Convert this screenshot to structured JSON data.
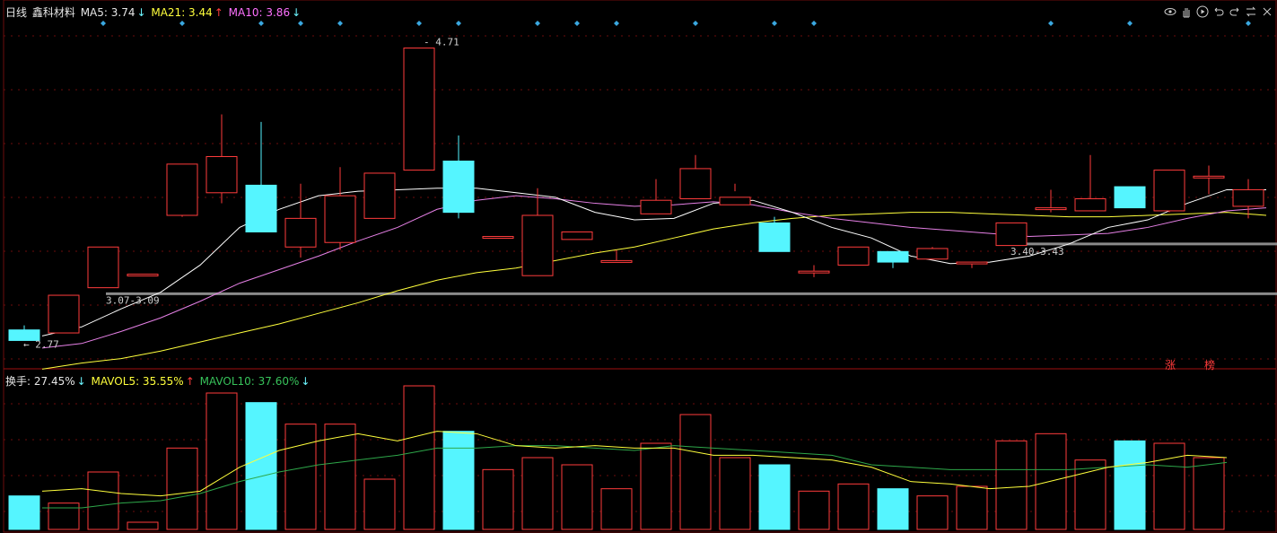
{
  "header": {
    "period": "日线",
    "stock": "鑫科材料",
    "ma5_label": "MA5: 3.74",
    "ma5_arrow": "↓",
    "ma21_label": "MA21: 3.44",
    "ma21_arrow": "↑",
    "ma10_label": "MA10: 3.86",
    "ma10_arrow": "↓"
  },
  "vol_header": {
    "turnover_label": "换手: 27.45%",
    "turnover_arrow": "↓",
    "mavol5_label": "MAVOL5: 35.55%",
    "mavol5_arrow": "↑",
    "mavol10_label": "MAVOL10: 37.60%",
    "mavol10_arrow": "↓"
  },
  "toolbar": {
    "icons": [
      "eye-icon",
      "hand-icon",
      "play-icon",
      "undo-icon",
      "redo-icon",
      "swap-icon",
      "close-icon"
    ]
  },
  "tags": {
    "zhang": "涨",
    "bang": "榜"
  },
  "colors": {
    "up": "#ff3c3c",
    "down": "#55f5ff",
    "ma5": "#ffffff",
    "ma10": "#e680e6",
    "ma21": "#ffff3c",
    "mavol5": "#ffff3c",
    "mavol10": "#2ea84a",
    "grid": "#6b0d0d",
    "support": "#8a8a8a"
  },
  "chart_data": {
    "type": "candlestick",
    "ylim": [
      2.6,
      4.85
    ],
    "candles": [
      {
        "o": 2.84,
        "h": 2.87,
        "l": 2.77,
        "c": 2.77
      },
      {
        "o": 2.82,
        "h": 3.07,
        "l": 2.82,
        "c": 3.07
      },
      {
        "o": 3.12,
        "h": 3.39,
        "l": 3.12,
        "c": 3.39
      },
      {
        "o": 3.21,
        "h": 3.21,
        "l": 3.21,
        "c": 3.21
      },
      {
        "o": 3.6,
        "h": 3.94,
        "l": 3.59,
        "c": 3.94
      },
      {
        "o": 3.75,
        "h": 4.27,
        "l": 3.68,
        "c": 3.99
      },
      {
        "o": 3.8,
        "h": 4.22,
        "l": 3.8,
        "c": 3.49
      },
      {
        "o": 3.39,
        "h": 3.81,
        "l": 3.32,
        "c": 3.58
      },
      {
        "o": 3.42,
        "h": 3.92,
        "l": 3.37,
        "c": 3.73
      },
      {
        "o": 3.58,
        "h": 3.69,
        "l": 3.58,
        "c": 3.88
      },
      {
        "o": 3.9,
        "h": 4.71,
        "l": 3.9,
        "c": 4.71
      },
      {
        "o": 3.96,
        "h": 4.13,
        "l": 3.58,
        "c": 3.62
      },
      {
        "o": 3.46,
        "h": 3.46,
        "l": 3.46,
        "c": 3.46
      },
      {
        "o": 3.2,
        "h": 3.78,
        "l": 3.2,
        "c": 3.6
      },
      {
        "o": 3.44,
        "h": 3.5,
        "l": 3.5,
        "c": 3.49
      },
      {
        "o": 3.3,
        "h": 3.37,
        "l": 3.3,
        "c": 3.3
      },
      {
        "o": 3.61,
        "h": 3.84,
        "l": 3.66,
        "c": 3.7
      },
      {
        "o": 3.71,
        "h": 4.0,
        "l": 3.71,
        "c": 3.91
      },
      {
        "o": 3.67,
        "h": 3.81,
        "l": 3.76,
        "c": 3.72
      },
      {
        "o": 3.55,
        "h": 3.59,
        "l": 3.36,
        "c": 3.36
      },
      {
        "o": 3.23,
        "h": 3.27,
        "l": 3.19,
        "c": 3.23
      },
      {
        "o": 3.27,
        "h": 3.39,
        "l": 3.27,
        "c": 3.39
      },
      {
        "o": 3.36,
        "h": 3.36,
        "l": 3.25,
        "c": 3.29
      },
      {
        "o": 3.31,
        "h": 3.39,
        "l": 3.31,
        "c": 3.38
      },
      {
        "o": 3.29,
        "h": 3.29,
        "l": 3.25,
        "c": 3.29
      },
      {
        "o": 3.4,
        "h": 3.55,
        "l": 3.4,
        "c": 3.55
      },
      {
        "o": 3.65,
        "h": 3.77,
        "l": 3.62,
        "c": 3.65
      },
      {
        "o": 3.63,
        "h": 4.0,
        "l": 3.63,
        "c": 3.71
      },
      {
        "o": 3.79,
        "h": 3.79,
        "l": 3.72,
        "c": 3.65
      },
      {
        "o": 3.63,
        "h": 3.9,
        "l": 3.62,
        "c": 3.9
      },
      {
        "o": 3.86,
        "h": 3.93,
        "l": 3.74,
        "c": 3.86
      },
      {
        "o": 3.66,
        "h": 3.84,
        "l": 3.58,
        "c": 3.77
      }
    ],
    "ma5": [
      2.8,
      2.86,
      2.98,
      3.09,
      3.27,
      3.52,
      3.64,
      3.73,
      3.76,
      3.77,
      3.78,
      3.78,
      3.75,
      3.72,
      3.62,
      3.57,
      3.58,
      3.68,
      3.7,
      3.62,
      3.52,
      3.45,
      3.33,
      3.28,
      3.29,
      3.33,
      3.41,
      3.52,
      3.57,
      3.68,
      3.77,
      3.77
    ],
    "ma10": [
      2.72,
      2.75,
      2.83,
      2.92,
      3.03,
      3.15,
      3.24,
      3.33,
      3.43,
      3.52,
      3.64,
      3.7,
      3.73,
      3.71,
      3.68,
      3.66,
      3.67,
      3.69,
      3.67,
      3.62,
      3.58,
      3.55,
      3.52,
      3.5,
      3.48,
      3.46,
      3.47,
      3.48,
      3.52,
      3.58,
      3.63,
      3.65
    ],
    "ma21": [
      2.58,
      2.62,
      2.65,
      2.7,
      2.76,
      2.82,
      2.88,
      2.95,
      3.02,
      3.1,
      3.17,
      3.22,
      3.25,
      3.3,
      3.35,
      3.39,
      3.45,
      3.51,
      3.55,
      3.58,
      3.6,
      3.61,
      3.62,
      3.62,
      3.61,
      3.6,
      3.59,
      3.59,
      3.6,
      3.61,
      3.62,
      3.6
    ],
    "support_lines": [
      {
        "label": "3.07-3.09",
        "value": 3.08
      },
      {
        "label": "3.40-3.43",
        "value": 3.41
      }
    ],
    "annotations": [
      {
        "text": "4.71",
        "candle": 10
      },
      {
        "text": "2.77",
        "candle": 0
      }
    ],
    "event_markers": [
      0,
      2,
      4,
      5,
      6,
      8,
      9,
      11,
      12,
      13,
      15,
      17,
      18,
      24,
      26,
      29,
      30
    ],
    "volume": {
      "ylim": [
        0,
        60
      ],
      "values": [
        14,
        11,
        24,
        3,
        34,
        57,
        53,
        44,
        44,
        21,
        60,
        41,
        25,
        30,
        27,
        17,
        36,
        48,
        30,
        27,
        16,
        19,
        17,
        14,
        18,
        37,
        40,
        29,
        37,
        36,
        30
      ]
    },
    "mavol5": [
      16,
      17,
      15,
      14,
      16,
      26,
      33,
      37,
      40,
      37,
      41,
      40,
      35,
      34,
      35,
      34,
      34,
      31,
      31,
      30,
      29,
      26,
      20,
      19,
      17,
      18,
      22,
      26,
      28,
      31,
      30
    ],
    "mavol10": [
      9,
      9,
      11,
      12,
      15,
      20,
      24,
      27,
      29,
      31,
      34,
      34,
      35,
      35,
      34,
      33,
      35,
      34,
      33,
      32,
      31,
      27,
      26,
      25,
      25,
      25,
      25,
      26,
      27,
      26,
      28
    ]
  }
}
